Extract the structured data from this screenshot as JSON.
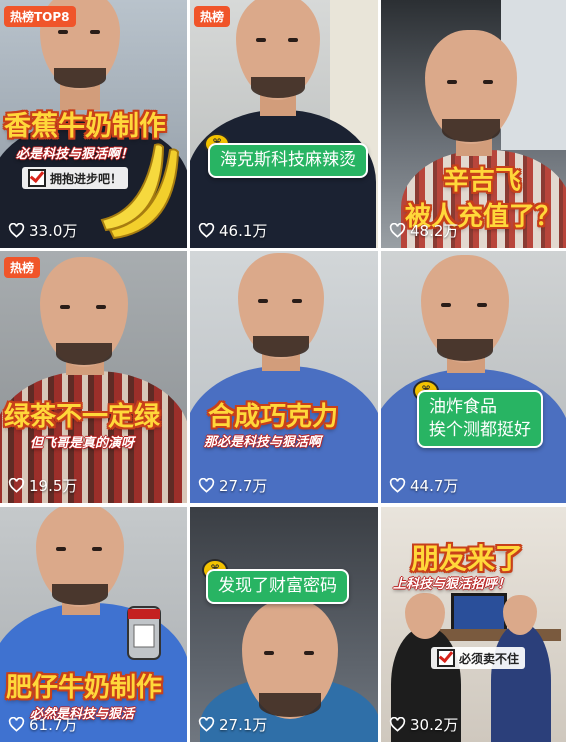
{
  "colors": {
    "badge": "#f0552a",
    "caption_yellow": "#ffd83a",
    "caption_outline": "#c8401a",
    "tag_green": "#28b463"
  },
  "videos": [
    {
      "badge": "热榜TOP8",
      "title": "香蕉牛奶制作",
      "subtitle": "必是科技与狠活啊！",
      "check_text": "拥抱进步吧！",
      "likes": "33.0万"
    },
    {
      "badge": "热榜",
      "tag": "海克斯科技麻辣烫",
      "likes": "46.1万"
    },
    {
      "title_line1": "辛吉飞",
      "title_line2": "被人充值了？",
      "likes": "48.2万"
    },
    {
      "badge": "热榜",
      "title": "绿茶不一定绿",
      "subtitle": "但飞哥是真的演呀",
      "likes": "19.5万"
    },
    {
      "title": "合成巧克力",
      "subtitle": "那必是科技与狠活啊",
      "likes": "27.7万"
    },
    {
      "tag_line1": "油炸食品",
      "tag_line2": "挨个测都挺好",
      "likes": "44.7万"
    },
    {
      "title": "肥仔牛奶制作",
      "subtitle": "必然是科技与狠活",
      "likes": "61.7万"
    },
    {
      "tag": "发现了财富密码",
      "likes": "27.1万"
    },
    {
      "title": "朋友来了",
      "subtitle": "上科技与狠活招呼！",
      "check_text": "必须卖不住",
      "likes": "30.2万"
    }
  ],
  "icons": {
    "like": "heart-outline-icon",
    "pin": "tag-pin-icon",
    "check": "checkbox-icon"
  }
}
